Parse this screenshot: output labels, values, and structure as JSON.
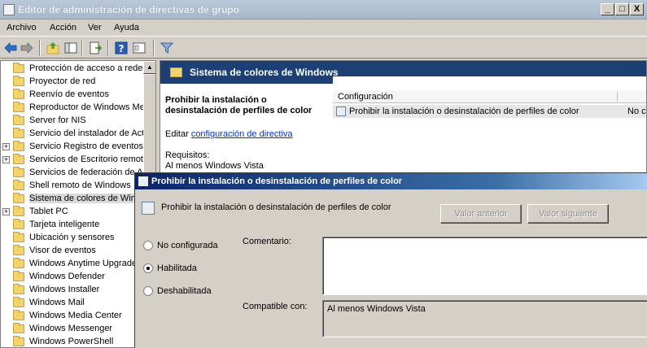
{
  "window": {
    "title": "Editor de administración de directivas de grupo",
    "controls": [
      "_",
      "□",
      "X"
    ]
  },
  "menu": [
    "Archivo",
    "Acción",
    "Ver",
    "Ayuda"
  ],
  "toolbar": {
    "icons": [
      "back-arrow-icon",
      "forward-arrow-icon",
      "up-folder-icon",
      "show-hide-tree-icon",
      "export-list-icon",
      "help-icon",
      "properties-icon",
      "filter-icon"
    ]
  },
  "tree": {
    "items": [
      {
        "label": "Protección de acceso a redes",
        "expandable": false
      },
      {
        "label": "Proyector de red",
        "expandable": false
      },
      {
        "label": "Reenvío de eventos",
        "expandable": false
      },
      {
        "label": "Reproductor de Windows Media",
        "expandable": false
      },
      {
        "label": "Server for NIS",
        "expandable": false
      },
      {
        "label": "Servicio del instalador de ActiveX",
        "expandable": false
      },
      {
        "label": "Servicio Registro de eventos",
        "expandable": true
      },
      {
        "label": "Servicios de Escritorio remoto",
        "expandable": true
      },
      {
        "label": "Servicios de federación de Active Directory",
        "expandable": false
      },
      {
        "label": "Shell remoto de Windows",
        "expandable": false
      },
      {
        "label": "Sistema de colores de Windows",
        "expandable": false,
        "selected": true
      },
      {
        "label": "Tablet PC",
        "expandable": true
      },
      {
        "label": "Tarjeta inteligente",
        "expandable": false
      },
      {
        "label": "Ubicación y sensores",
        "expandable": false
      },
      {
        "label": "Visor de eventos",
        "expandable": false
      },
      {
        "label": "Windows Anytime Upgrade",
        "expandable": false
      },
      {
        "label": "Windows Defender",
        "expandable": false
      },
      {
        "label": "Windows Installer",
        "expandable": false
      },
      {
        "label": "Windows Mail",
        "expandable": false
      },
      {
        "label": "Windows Media Center",
        "expandable": false
      },
      {
        "label": "Windows Messenger",
        "expandable": false
      },
      {
        "label": "Windows PowerShell",
        "expandable": false
      }
    ]
  },
  "right_pane": {
    "header_title": "Sistema de colores de Windows",
    "policy_title": "Prohibir la instalación o desinstalación de perfiles de color",
    "edit_prefix": "Editar",
    "edit_link": "configuración de directiva",
    "requirements_label": "Requisitos:",
    "requirements_value": "Al menos Windows Vista",
    "list": {
      "column_header": "Configuración",
      "row_text": "Prohibir la instalación o desinstalación de perfiles de color",
      "row_state": "No c"
    }
  },
  "dialog": {
    "title": "Prohibir la instalación o desinstalación de perfiles de color",
    "subtitle": "Prohibir la instalación o desinstalación de perfiles de color",
    "prev_button": "Valor anterior",
    "next_button": "Valor siguiente",
    "options": [
      {
        "label": "No configurada",
        "checked": false
      },
      {
        "label": "Habilitada",
        "checked": true
      },
      {
        "label": "Deshabilitada",
        "checked": false
      }
    ],
    "comment_label": "Comentario:",
    "comment_value": "",
    "compatible_label": "Compatible con:",
    "compatible_value": "Al menos Windows Vista"
  }
}
